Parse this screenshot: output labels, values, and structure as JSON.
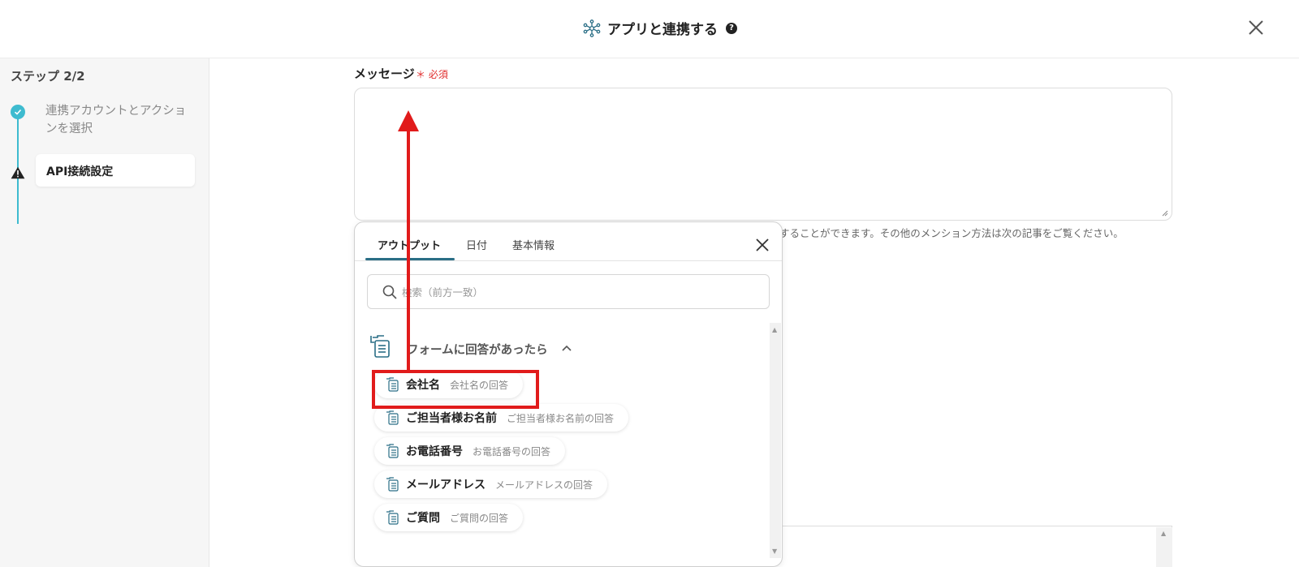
{
  "header": {
    "title": "アプリと連携する",
    "help": "?"
  },
  "sidebar": {
    "step_count": "ステップ 2/2",
    "steps": [
      {
        "label": "連携アカウントとアクションを選択",
        "status": "done"
      },
      {
        "label": "API接続設定",
        "status": "warning"
      }
    ]
  },
  "message": {
    "label": "メッセージ",
    "required": "＊ 必須",
    "value": ""
  },
  "hint": "することができます。その他のメンション方法は次の記事をご覧ください。",
  "popup": {
    "tabs": [
      {
        "label": "アウトプット",
        "active": true
      },
      {
        "label": "日付",
        "active": false
      },
      {
        "label": "基本情報",
        "active": false
      }
    ],
    "search_placeholder": "検索（前方一致）",
    "group": {
      "label": "フォームに回答があったら",
      "expanded": true
    },
    "items": [
      {
        "name": "会社名",
        "desc": "会社名の回答"
      },
      {
        "name": "ご担当者様お名前",
        "desc": "ご担当者様お名前の回答"
      },
      {
        "name": "お電話番号",
        "desc": "お電話番号の回答"
      },
      {
        "name": "メールアドレス",
        "desc": "メールアドレスの回答"
      },
      {
        "name": "ご質問",
        "desc": "ご質問の回答"
      }
    ]
  },
  "colors": {
    "accent": "#3ebbcf",
    "tab_underline": "#2a6e86",
    "required": "#e02b2b",
    "annotation": "#e11b1b"
  }
}
